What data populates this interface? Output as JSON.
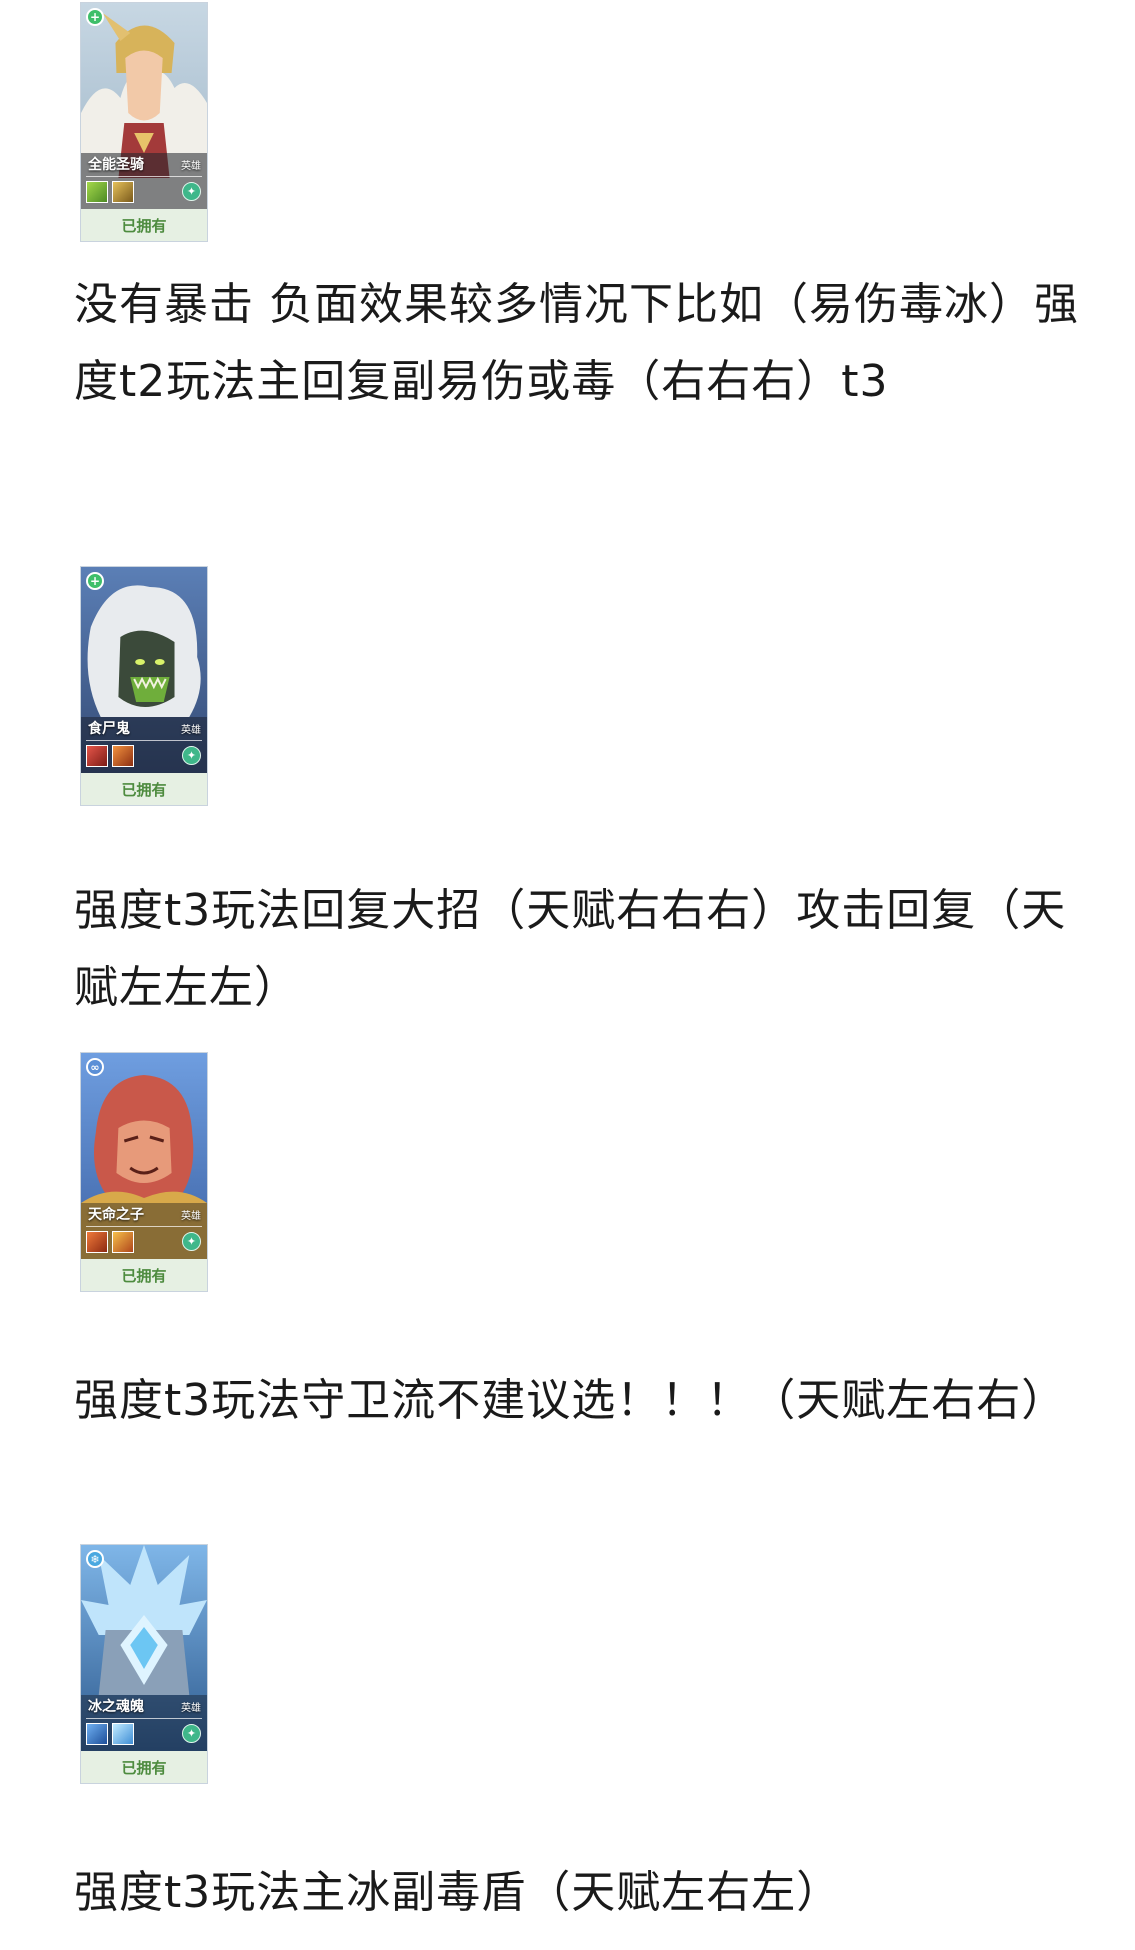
{
  "heroes": [
    {
      "name": "全能圣骑",
      "tag": "英雄",
      "owned_label": "已拥有",
      "badge_icon": "plus",
      "badge_color": "#3fbf6a",
      "skill_colors": [
        "#7bbf3a",
        "#c69a2f"
      ],
      "note": "没有暴击 负面效果较多情况下比如（易伤毒冰）强度t2玩法主回复副易伤或毒（右右右）t3"
    },
    {
      "name": "食尸鬼",
      "tag": "英雄",
      "owned_label": "已拥有",
      "badge_icon": "plus",
      "badge_color": "#3fbf6a",
      "skill_colors": [
        "#c23a2e",
        "#d9622a"
      ],
      "note": "强度t3玩法回复大招（天赋右右右）攻击回复（天赋左左左）"
    },
    {
      "name": "天命之子",
      "tag": "英雄",
      "owned_label": "已拥有",
      "badge_icon": "infinity",
      "badge_color": "#5b8fd6",
      "skill_colors": [
        "#d7552a",
        "#e3902f"
      ],
      "note": "强度t3玩法守卫流不建议选！！！（天赋左右右）"
    },
    {
      "name": "冰之魂魄",
      "tag": "英雄",
      "owned_label": "已拥有",
      "badge_icon": "snowflake",
      "badge_color": "#4aa8e0",
      "skill_colors": [
        "#3d86d8",
        "#6fc1f0"
      ],
      "note": "强度t3玩法主冰副毒盾（天赋左右左）"
    }
  ]
}
